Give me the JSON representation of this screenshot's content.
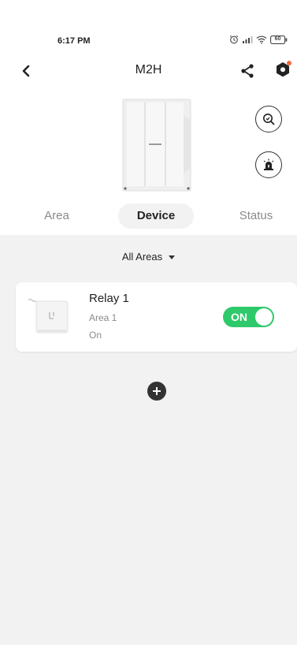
{
  "status_bar": {
    "time": "6:17 PM",
    "battery": "60"
  },
  "header": {
    "title": "M2H"
  },
  "tabs": [
    {
      "label": "Area",
      "active": false
    },
    {
      "label": "Device",
      "active": true
    },
    {
      "label": "Status",
      "active": false
    }
  ],
  "filter": {
    "label": "All Areas"
  },
  "devices": [
    {
      "name": "Relay 1",
      "area": "Area 1",
      "state": "On",
      "toggle_label": "ON",
      "toggle_on": true
    }
  ],
  "colors": {
    "toggle_on": "#2ec96a",
    "notification_dot": "#f06a3d",
    "panel_bg": "#f2f2f2"
  },
  "icons": {
    "back": "back-arrow-icon",
    "share": "share-icon",
    "settings": "settings-gear-icon",
    "search": "zoom-search-icon",
    "alarm": "siren-icon",
    "add": "plus-icon"
  }
}
